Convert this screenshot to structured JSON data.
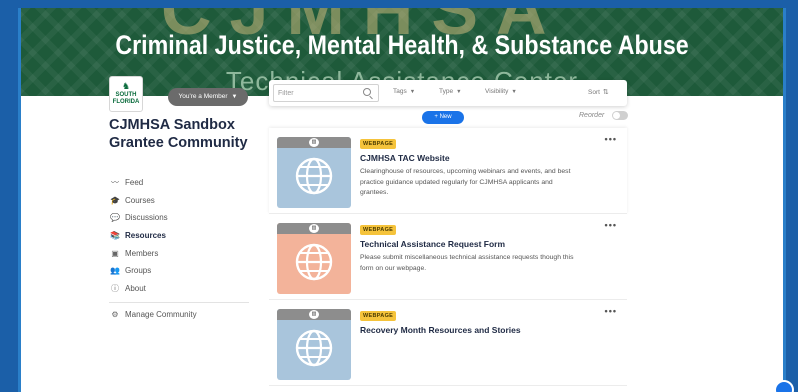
{
  "colors": {
    "banner_bg": "#1e5a3a",
    "accent": "#1a73e8",
    "badge": "#f5c33b",
    "title": "#1f2a44",
    "thumb_blue": "#a9c5dc",
    "thumb_peach": "#f3b39a"
  },
  "banner": {
    "title": "Criminal Justice, Mental Health, & Substance Abuse",
    "subtitle": "Technical Assistance Center"
  },
  "logo": {
    "text_line1": "SOUTH",
    "text_line2": "FLORIDA"
  },
  "member_button": {
    "label": "You're a Member",
    "icon": "chevron-down-icon"
  },
  "filter_bar": {
    "search_placeholder": "Filter",
    "tags_label": "Tags",
    "type_label": "Type",
    "visibility_label": "Visibility",
    "sort_label": "Sort"
  },
  "new_button": {
    "label": "+ New"
  },
  "reorder": {
    "label": "Reorder",
    "enabled": false
  },
  "community": {
    "title": "CJMHSA Sandbox Grantee Community"
  },
  "sidebar": {
    "items": [
      {
        "label": "Feed",
        "icon": "activity-icon",
        "active": false
      },
      {
        "label": "Courses",
        "icon": "graduation-cap-icon",
        "active": false
      },
      {
        "label": "Discussions",
        "icon": "chat-bubbles-icon",
        "active": false
      },
      {
        "label": "Resources",
        "icon": "books-icon",
        "active": true
      },
      {
        "label": "Members",
        "icon": "member-card-icon",
        "active": false
      },
      {
        "label": "Groups",
        "icon": "group-icon",
        "active": false
      },
      {
        "label": "About",
        "icon": "info-icon",
        "active": false
      }
    ],
    "manage_label": "Manage Community"
  },
  "resources": [
    {
      "badge": "WEBPAGE",
      "title": "CJMHSA TAC Website",
      "description": "Clearinghouse of resources, upcoming webinars and events, and best practice guidance updated regularly for CJMHSA applicants and grantees.",
      "thumb_color": "#a9c5dc"
    },
    {
      "badge": "WEBPAGE",
      "title": "Technical Assistance Request Form",
      "description": "Please submit miscellaneous technical assistance requests though this form on our webpage.",
      "thumb_color": "#f3b39a"
    },
    {
      "badge": "WEBPAGE",
      "title": "Recovery Month Resources and Stories",
      "description": "",
      "thumb_color": "#a9c5dc"
    }
  ]
}
